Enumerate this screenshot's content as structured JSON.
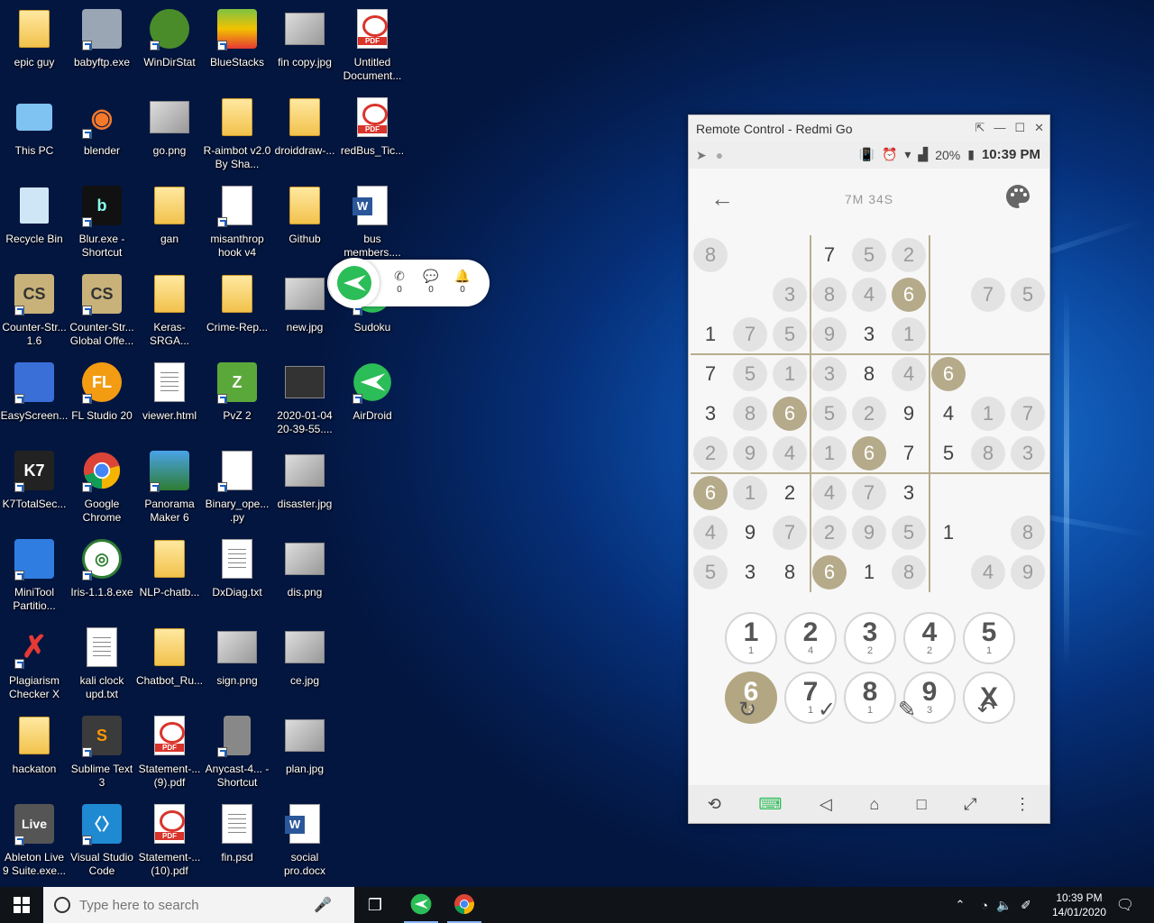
{
  "desktop": {
    "icons": [
      {
        "label": "epic guy"
      },
      {
        "label": "babyftp.exe"
      },
      {
        "label": "WinDirStat"
      },
      {
        "label": "BlueStacks"
      },
      {
        "label": "fin copy.jpg"
      },
      {
        "label": "Untitled Document..."
      },
      {
        "label": "This PC"
      },
      {
        "label": "blender"
      },
      {
        "label": "go.png"
      },
      {
        "label": "R-aimbot v2.0 By Sha..."
      },
      {
        "label": "droiddraw-..."
      },
      {
        "label": "redBus_Tic..."
      },
      {
        "label": "Recycle Bin"
      },
      {
        "label": "Blur.exe - Shortcut"
      },
      {
        "label": "gan"
      },
      {
        "label": "misanthrop hook v4"
      },
      {
        "label": "Github"
      },
      {
        "label": "bus members...."
      },
      {
        "label": "Counter-Str... 1.6"
      },
      {
        "label": "Counter-Str... Global Offe..."
      },
      {
        "label": "Keras-SRGA..."
      },
      {
        "label": "Crime-Rep..."
      },
      {
        "label": "new.jpg"
      },
      {
        "label": "Sudoku"
      },
      {
        "label": "EasyScreen..."
      },
      {
        "label": "FL Studio 20"
      },
      {
        "label": "viewer.html"
      },
      {
        "label": "PvZ 2"
      },
      {
        "label": "2020-01-04 20-39-55...."
      },
      {
        "label": "AirDroid"
      },
      {
        "label": "K7TotalSec..."
      },
      {
        "label": "Google Chrome"
      },
      {
        "label": "Panorama Maker 6"
      },
      {
        "label": "Binary_ope... .py"
      },
      {
        "label": "disaster.jpg"
      },
      {
        "label": "MiniTool Partitio..."
      },
      {
        "label": "Iris-1.1.8.exe"
      },
      {
        "label": "NLP-chatb..."
      },
      {
        "label": "DxDiag.txt"
      },
      {
        "label": "dis.png"
      },
      {
        "label": "Plagiarism Checker X"
      },
      {
        "label": "kali clock upd.txt"
      },
      {
        "label": "Chatbot_Ru..."
      },
      {
        "label": "sign.png"
      },
      {
        "label": "ce.jpg"
      },
      {
        "label": "hackaton"
      },
      {
        "label": "Sublime Text 3"
      },
      {
        "label": "Statement-... (9).pdf"
      },
      {
        "label": "Anycast-4... - Shortcut"
      },
      {
        "label": "plan.jpg"
      },
      {
        "label": "Ableton Live 9 Suite.exe..."
      },
      {
        "label": "Visual Studio Code"
      },
      {
        "label": "Statement-... (10).pdf"
      },
      {
        "label": "fin.psd"
      },
      {
        "label": "social pro.docx"
      }
    ]
  },
  "airdroid_widget": {
    "calls": "0",
    "messages": "0",
    "notifications": "0"
  },
  "remote_window": {
    "title": "Remote Control - Redmi Go",
    "status": {
      "battery": "20%",
      "time": "10:39 PM"
    },
    "sudoku": {
      "timer": "7M 34S",
      "grid": [
        [
          "h8",
          "",
          "",
          "7",
          "h5",
          "h2",
          "",
          "",
          ""
        ],
        [
          "",
          "",
          "h3",
          "h8",
          "h4",
          "s6",
          "",
          "h7",
          "h5"
        ],
        [
          "1",
          "h7",
          "h5",
          "h9",
          "3",
          "h1",
          "",
          "",
          ""
        ],
        [
          "7",
          "h5",
          "h1",
          "h3",
          "8",
          "h4",
          "s6",
          "",
          ""
        ],
        [
          "3",
          "h8",
          "s6",
          "h5",
          "h2",
          "9",
          "4",
          "h1",
          "h7"
        ],
        [
          "h2",
          "h9",
          "h4",
          "h1",
          "s6",
          "7",
          "5",
          "h8",
          "h3"
        ],
        [
          "s6",
          "h1",
          "2",
          "h4",
          "h7",
          "3",
          "",
          "",
          ""
        ],
        [
          "h4",
          "9",
          "h7",
          "h2",
          "h9",
          "h5",
          "1",
          "",
          "h8"
        ],
        [
          "h5",
          "3",
          "8",
          "s6",
          "1",
          "h8",
          "",
          "h4",
          "h9"
        ]
      ],
      "keypad": [
        {
          "num": "1",
          "count": "1"
        },
        {
          "num": "2",
          "count": "4"
        },
        {
          "num": "3",
          "count": "2"
        },
        {
          "num": "4",
          "count": "2"
        },
        {
          "num": "5",
          "count": "1"
        },
        {
          "num": "6",
          "count": "3"
        },
        {
          "num": "7",
          "count": "1"
        },
        {
          "num": "8",
          "count": "1"
        },
        {
          "num": "9",
          "count": "3"
        },
        {
          "num": "X",
          "count": ""
        }
      ]
    }
  },
  "taskbar": {
    "search_placeholder": "Type here to search",
    "time": "10:39 PM",
    "date": "14/01/2020"
  },
  "colors": {
    "accent": "#b3a682",
    "taskbar": "#101318",
    "hint_circle": "#e3e3e3"
  }
}
